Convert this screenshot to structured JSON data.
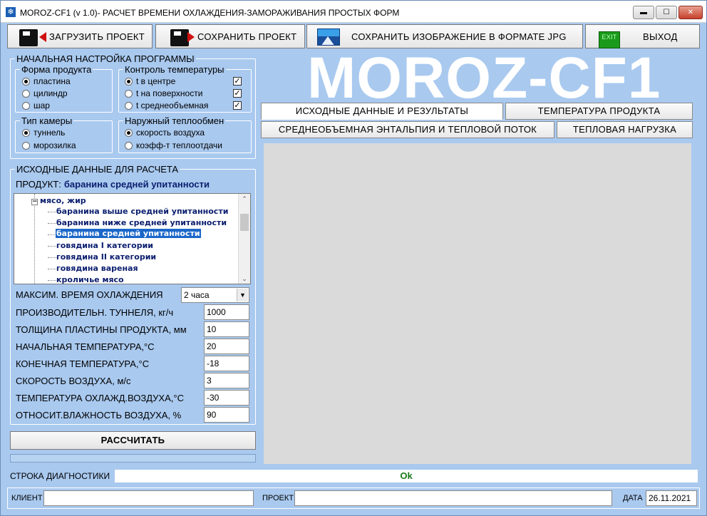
{
  "window": {
    "title": "MOROZ-CF1 (v 1.0)- РАСЧЕТ ВРЕМЕНИ ОХЛАЖДЕНИЯ-ЗАМОРАЖИВАНИЯ ПРОСТЫХ ФОРМ",
    "min_glyph": "▬",
    "max_glyph": "☐",
    "close_glyph": "✕",
    "app_icon_glyph": "❄"
  },
  "toolbar": {
    "load_label": "ЗАГРУЗИТЬ ПРОЕКТ",
    "save_label": "СОХРАНИТЬ ПРОЕКТ",
    "save_image_label": "СОХРАНИТЬ ИЗОБРАЖЕНИЕ В ФОРМАТЕ JPG",
    "exit_icon_text": "EXIT",
    "exit_label": "ВЫХОД"
  },
  "settings": {
    "legend": "НАЧАЛЬНАЯ НАСТРОЙКА ПРОГРАММЫ",
    "shape": {
      "legend": "Форма продукта",
      "options": [
        "пластина",
        "цилиндр",
        "шар"
      ],
      "selected": 0
    },
    "temp_control": {
      "legend": "Контроль температуры",
      "options": [
        "t в центре",
        "t на поверхности",
        "t среднеобъемная"
      ],
      "selected": 0,
      "checks": [
        true,
        true,
        true
      ]
    },
    "chamber": {
      "legend": "Тип камеры",
      "options": [
        "туннель",
        "морозилка"
      ],
      "selected": 0
    },
    "heat_exchange": {
      "legend": "Наружный теплообмен",
      "options": [
        "скорость воздуха",
        "коэфф-т теплоотдачи"
      ],
      "selected": 0
    }
  },
  "input_data": {
    "legend": "ИСХОДНЫЕ ДАННЫЕ ДЛЯ РАСЧЕТА",
    "product_label": "ПРОДУКТ:",
    "product_value": "баранина средней упитанности",
    "tree": {
      "parent": "мясо, жир",
      "items": [
        "баранина выше средней упитанности",
        "баранина ниже средней упитанности",
        "баранина средней упитанности",
        "говядина I категории",
        "говядина II категории",
        "говядина вареная",
        "кроличье мясо"
      ],
      "selected": 2
    },
    "max_time": {
      "label": "МАКСИМ. ВРЕМЯ ОХЛАЖДЕНИЯ",
      "value": "2 часа"
    },
    "params": [
      {
        "label": "ПРОИЗВОДИТЕЛЬН. ТУННЕЛЯ, кг/ч",
        "value": "1000"
      },
      {
        "label": "ТОЛЩИНА ПЛАСТИНЫ ПРОДУКТА, мм",
        "value": "10"
      },
      {
        "label": "НАЧАЛЬНАЯ ТЕМПЕРАТУРА,°С",
        "value": "20"
      },
      {
        "label": "КОНЕЧНАЯ ТЕМПЕРАТУРА,°С",
        "value": "-18"
      },
      {
        "label": "СКОРОСТЬ ВОЗДУХА, м/с",
        "value": "3"
      },
      {
        "label": "ТЕМПЕРАТУРА ОХЛАЖД.ВОЗДУХА,°С",
        "value": "-30"
      },
      {
        "label": "ОТНОСИТ.ВЛАЖНОСТЬ ВОЗДУХА, %",
        "value": "90"
      }
    ],
    "calc_label": "РАССЧИТАТЬ"
  },
  "logo": "MOROZ-CF1",
  "tabs": [
    "ИСХОДНЫЕ ДАННЫЕ И РЕЗУЛЬТАТЫ",
    "ТЕМПЕРАТУРА ПРОДУКТА",
    "СРЕДНЕОБЪЕМНАЯ ЭНТАЛЬПИЯ И ТЕПЛОВОЙ ПОТОК",
    "ТЕПЛОВАЯ НАГРУЗКА"
  ],
  "active_tab": 0,
  "diagnostics": {
    "label": "СТРОКА ДИАГНОСТИКИ",
    "value": "Ok"
  },
  "footer": {
    "client_label": "КЛИЕНТ",
    "client_value": "",
    "project_label": "ПРОЕКТ",
    "project_value": "",
    "date_label": "ДАТА",
    "date_value": "26.11.2021"
  },
  "colors": {
    "background": "#a9c9ef",
    "logo": "#ffffff",
    "tree_selection": "#1b67c9",
    "diagnostic_ok": "#1a7a1a",
    "close_button": "#c7402c"
  }
}
